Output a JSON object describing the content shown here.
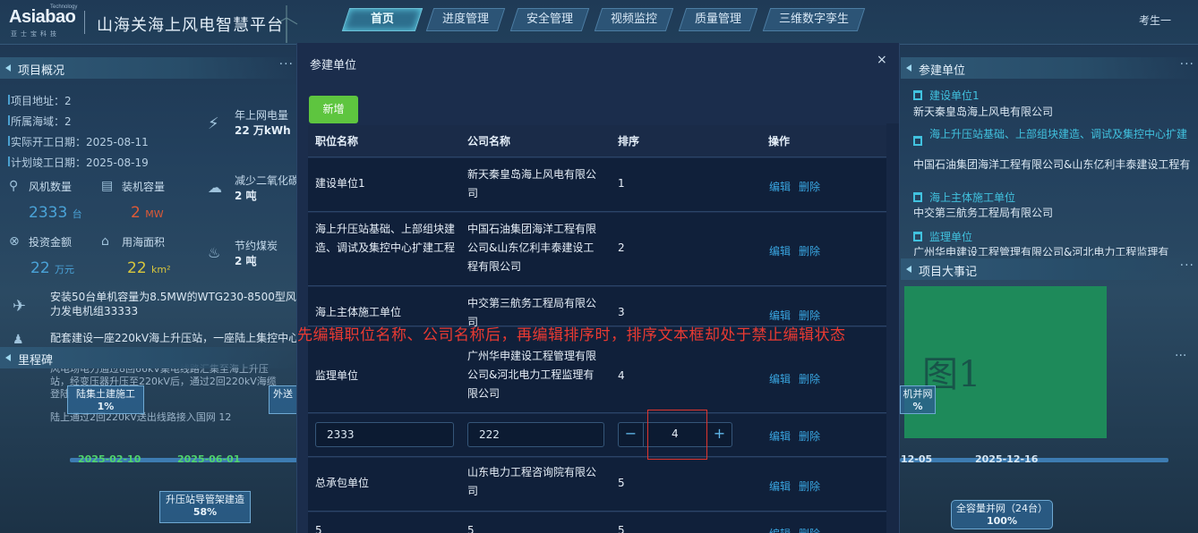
{
  "header": {
    "logo_brand": "Asiabao",
    "logo_tech": "Technology",
    "logo_sub": "亚士宝科技",
    "title": "山海关海上风电智慧平台",
    "nav": [
      {
        "label": "首页",
        "active": true
      },
      {
        "label": "进度管理",
        "active": false
      },
      {
        "label": "安全管理",
        "active": false
      },
      {
        "label": "视频监控",
        "active": false
      },
      {
        "label": "质量管理",
        "active": false
      },
      {
        "label": "三维数字孪生",
        "active": false
      }
    ],
    "user": "考生一"
  },
  "left": {
    "overview_title": "项目概况",
    "overview_items": [
      "项目地址：2",
      "所属海域：2",
      "实际开工日期：2025-08-11",
      "计划竣工日期：2025-08-19"
    ],
    "metrics": [
      {
        "label": "风机数量",
        "value": "2333",
        "unit": "台",
        "color": "blue"
      },
      {
        "label": "装机容量",
        "value": "2",
        "unit": "MW",
        "color": "orange"
      },
      {
        "label": "投资金额",
        "value": "22",
        "unit": "万元",
        "color": "blue"
      },
      {
        "label": "用海面积",
        "value": "22",
        "unit": "km²",
        "color": "yellow"
      }
    ],
    "stats": [
      {
        "label": "年上网电量",
        "value": "22 万kWh"
      },
      {
        "label": "减少二氧化碳",
        "value": "2 吨"
      },
      {
        "label": "节约煤炭",
        "value": "2 吨"
      }
    ],
    "news": [
      "安装50台单机容量为8.5MW的WTG230-8500型风力发电机组33333",
      "配套建设一座220kV海上升压站，一座陆上集控中心",
      "风电场电力通过8回66kV集电线路汇集至海上升压站，经变压器升压至220kV后，通过2回220kV海缆登陆",
      "陆上通过2回220kV送出线路接入国网 12"
    ],
    "milestone_title": "里程碑",
    "milestones": [
      {
        "name": "陆集土建施工",
        "pct": "1%"
      },
      {
        "name": "外送",
        "pct": ""
      },
      {
        "name": "升压站导管架建造",
        "pct": "58%"
      }
    ],
    "dates": [
      "2025-02-10",
      "2025-06-01"
    ]
  },
  "right": {
    "units_title": "参建单位",
    "units": [
      {
        "name": "建设单位1",
        "company": "新天秦皇岛海上风电有限公司"
      },
      {
        "name": "海上升压站基础、上部组块建造、调试及集控中心扩建",
        "company": "中国石油集团海洋工程有限公司&山东亿利丰泰建设工程有"
      },
      {
        "name": "海上主体施工单位",
        "company": "中交第三航务工程局有限公司"
      },
      {
        "name": "监理单位",
        "company": "广州华申建设工程管理有限公司&河北电力工程监理有"
      }
    ],
    "events_title": "项目大事记",
    "figure_label": "图1",
    "milestone_partial": {
      "name": "机并网",
      "pct": "%"
    },
    "dates": [
      "12-05",
      "2025-12-16"
    ],
    "milestone_final": {
      "name": "全容量并网（24台）",
      "pct": "100%"
    }
  },
  "modal": {
    "title": "参建单位",
    "close": "×",
    "add_label": "新增",
    "columns": [
      "职位名称",
      "公司名称",
      "排序",
      "操作"
    ],
    "rows": [
      {
        "position": "建设单位1",
        "company": "新天秦皇岛海上风电有限公司",
        "order": "1"
      },
      {
        "position": "海上升压站基础、上部组块建造、调试及集控中心扩建工程",
        "company": "中国石油集团海洋工程有限公司&山东亿利丰泰建设工程有限公司",
        "order": "2"
      },
      {
        "position": "海上主体施工单位",
        "company": "中交第三航务工程局有限公司",
        "order": "3"
      },
      {
        "position": "监理单位",
        "company": "广州华申建设工程管理有限公司&河北电力工程监理有限公司",
        "order": "4"
      },
      {
        "position": "总承包单位",
        "company": "山东电力工程咨询院有限公司",
        "order": "5"
      },
      {
        "position": "5",
        "company": "5",
        "order": "5"
      }
    ],
    "edit_row": {
      "position": "2333",
      "company": "222",
      "order": "4",
      "minus": "−",
      "plus": "+"
    },
    "edit_label": "编辑",
    "delete_label": "删除"
  },
  "annotation": "先编辑职位名称、公司名称后，再编辑排序时，排序文本框却处于禁止编辑状态"
}
